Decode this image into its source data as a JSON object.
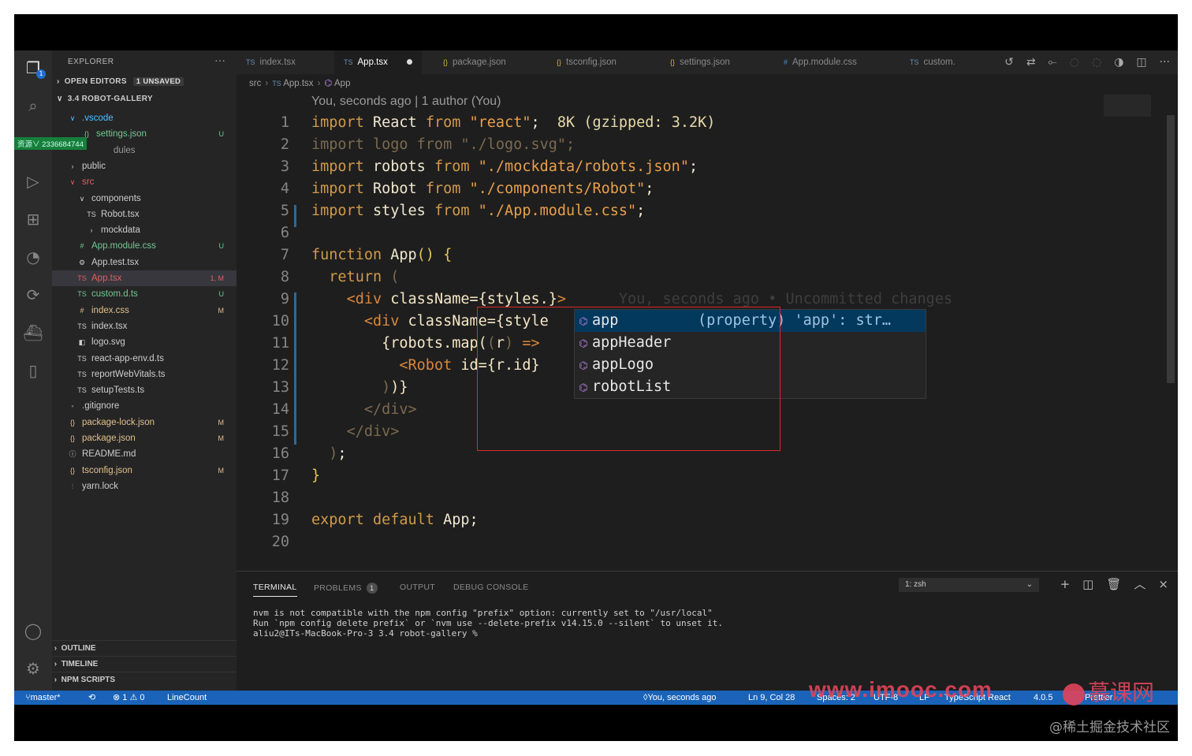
{
  "explorer": {
    "title": "EXPLORER",
    "more": "···",
    "open_editors": "OPEN EDITORS",
    "unsaved": "1 UNSAVED",
    "project": "3.4 ROBOT-GALLERY",
    "overlay": "资源∨ 2336684744",
    "tree": [
      {
        "label": ".vscode",
        "icon": "∨",
        "status": "",
        "color": "#4fc1ff"
      },
      {
        "label": "settings.json",
        "icon": "{}",
        "status": "U",
        "color": "#73c991"
      },
      {
        "label": "dules",
        "icon": "",
        "status": "",
        "color": "#999999"
      },
      {
        "label": "public",
        "icon": "›",
        "status": "",
        "color": "#cccccc"
      },
      {
        "label": "src",
        "icon": "∨",
        "status": "",
        "color": "#e06060"
      },
      {
        "label": "components",
        "icon": "∨",
        "status": "",
        "color": "#cccccc"
      },
      {
        "label": "Robot.tsx",
        "icon": "TS",
        "status": "",
        "color": "#cccccc"
      },
      {
        "label": "mockdata",
        "icon": "›",
        "status": "",
        "color": "#cccccc"
      },
      {
        "label": "App.module.css",
        "icon": "#",
        "status": "U",
        "color": "#73c991"
      },
      {
        "label": "App.test.tsx",
        "icon": "⚙",
        "status": "",
        "color": "#cccccc"
      },
      {
        "label": "App.tsx",
        "icon": "TS",
        "status": "1, M",
        "color": "#e06060"
      },
      {
        "label": "custom.d.ts",
        "icon": "TS",
        "status": "U",
        "color": "#73c991"
      },
      {
        "label": "index.css",
        "icon": "#",
        "status": "M",
        "color": "#e2c08d"
      },
      {
        "label": "index.tsx",
        "icon": "TS",
        "status": "",
        "color": "#cccccc"
      },
      {
        "label": "logo.svg",
        "icon": "◧",
        "status": "",
        "color": "#cccccc"
      },
      {
        "label": "react-app-env.d.ts",
        "icon": "TS",
        "status": "",
        "color": "#cccccc"
      },
      {
        "label": "reportWebVitals.ts",
        "icon": "TS",
        "status": "",
        "color": "#cccccc"
      },
      {
        "label": "setupTests.ts",
        "icon": "TS",
        "status": "",
        "color": "#cccccc"
      },
      {
        "label": ".gitignore",
        "icon": "◦",
        "status": "",
        "color": "#cccccc"
      },
      {
        "label": "package-lock.json",
        "icon": "{}",
        "status": "M",
        "color": "#e2c08d"
      },
      {
        "label": "package.json",
        "icon": "{}",
        "status": "M",
        "color": "#e2c08d"
      },
      {
        "label": "README.md",
        "icon": "ⓘ",
        "status": "",
        "color": "#cccccc"
      },
      {
        "label": "tsconfig.json",
        "icon": "{}",
        "status": "M",
        "color": "#e2c08d"
      },
      {
        "label": "yarn.lock",
        "icon": "⫶",
        "status": "",
        "color": "#cccccc"
      }
    ],
    "outline": "OUTLINE",
    "timeline": "TIMELINE",
    "npm_scripts": "NPM SCRIPTS"
  },
  "tabs": [
    {
      "label": "index.tsx"
    },
    {
      "label": "App.tsx"
    },
    {
      "label": "package.json"
    },
    {
      "label": "tsconfig.json"
    },
    {
      "label": "settings.json"
    },
    {
      "label": "App.module.css"
    },
    {
      "label": "custom."
    }
  ],
  "breadcrumb": {
    "a": "src",
    "b": "App.tsx",
    "c": "App"
  },
  "editor": {
    "blame": "You, seconds ago | 1 author (You)",
    "import_cost": "8K (gzipped: 3.2K)",
    "ghost": "You, seconds ago • Uncommitted changes",
    "lines": [
      "1",
      "2",
      "3",
      "4",
      "5",
      "6",
      "7",
      "8",
      "9",
      "10",
      "11",
      "12",
      "13",
      "14",
      "15",
      "16",
      "17",
      "18",
      "19",
      "20"
    ]
  },
  "suggest": {
    "items": [
      "app",
      "appHeader",
      "appLogo",
      "robotList"
    ],
    "detail": "(property) 'app': str…"
  },
  "panel": {
    "terminal": "TERMINAL",
    "problems": "PROBLEMS",
    "problems_count": "1",
    "output": "OUTPUT",
    "debug": "DEBUG CONSOLE",
    "shell": "1: zsh",
    "lines": [
      "nvm is not compatible with the npm config \"prefix\" option: currently set to \"/usr/local\"",
      "Run `npm config delete prefix` or `nvm use --delete-prefix v14.15.0 --silent` to unset it.",
      "aliu2@ITs-MacBook-Pro-3 3.4 robot-gallery %"
    ]
  },
  "status": {
    "branch": "master*",
    "errors": "⊗ 1 ⚠ 0",
    "linecount": "LineCount",
    "blame": "You, seconds ago",
    "position": "Ln 9, Col 28",
    "spaces": "Spaces: 2",
    "encoding": "UTF-8",
    "eol": "LF",
    "language": "TypeScript React",
    "version": "4.0.5",
    "tail": "Prettier"
  },
  "watermark": {
    "site": "www.imooc.com",
    "brand": "慕课网",
    "footer": "@稀土掘金技术社区"
  }
}
